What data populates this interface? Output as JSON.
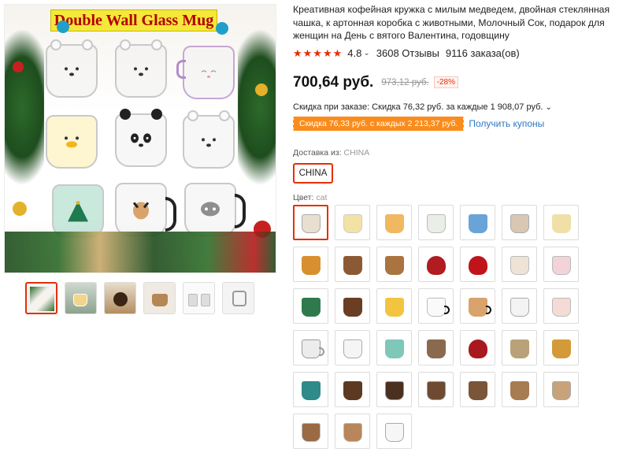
{
  "gallery": {
    "banner_text": "Double Wall Glass Mug",
    "thumb_count": 6
  },
  "product": {
    "title": "Креативная кофейная кружка с милым медведем, двойная стеклянная чашка, к артонная коробка с животными, Молочный Сок, подарок для женщин на День с вятого Валентина, годовщину",
    "stars": "★★★★★",
    "rating": "4.8",
    "rating_chevron": "⌄",
    "reviews": "3608 Отзывы",
    "orders": "9116 заказа(ов)",
    "price": "700,64 руб.",
    "old_price": "973,12 руб.",
    "discount": "-28%",
    "order_discount": "Скидка при заказе: Скидка 76,32 руб. за каждые 1 908,07 руб.",
    "order_discount_chevron": "⌄",
    "coupon_tag": "Скидка 76,33 руб. с каждых 2 213,37 руб.",
    "coupon_link": "Получить купоны",
    "ship_label": "Доставка из:",
    "ship_value": "CHINA",
    "ship_option": "CHINA",
    "color_label": "Цвет:",
    "color_value": "cat"
  },
  "colors": {
    "accent": "#e62e04",
    "coupon_bg": "#fb8c1c",
    "link": "#2f78c4"
  }
}
